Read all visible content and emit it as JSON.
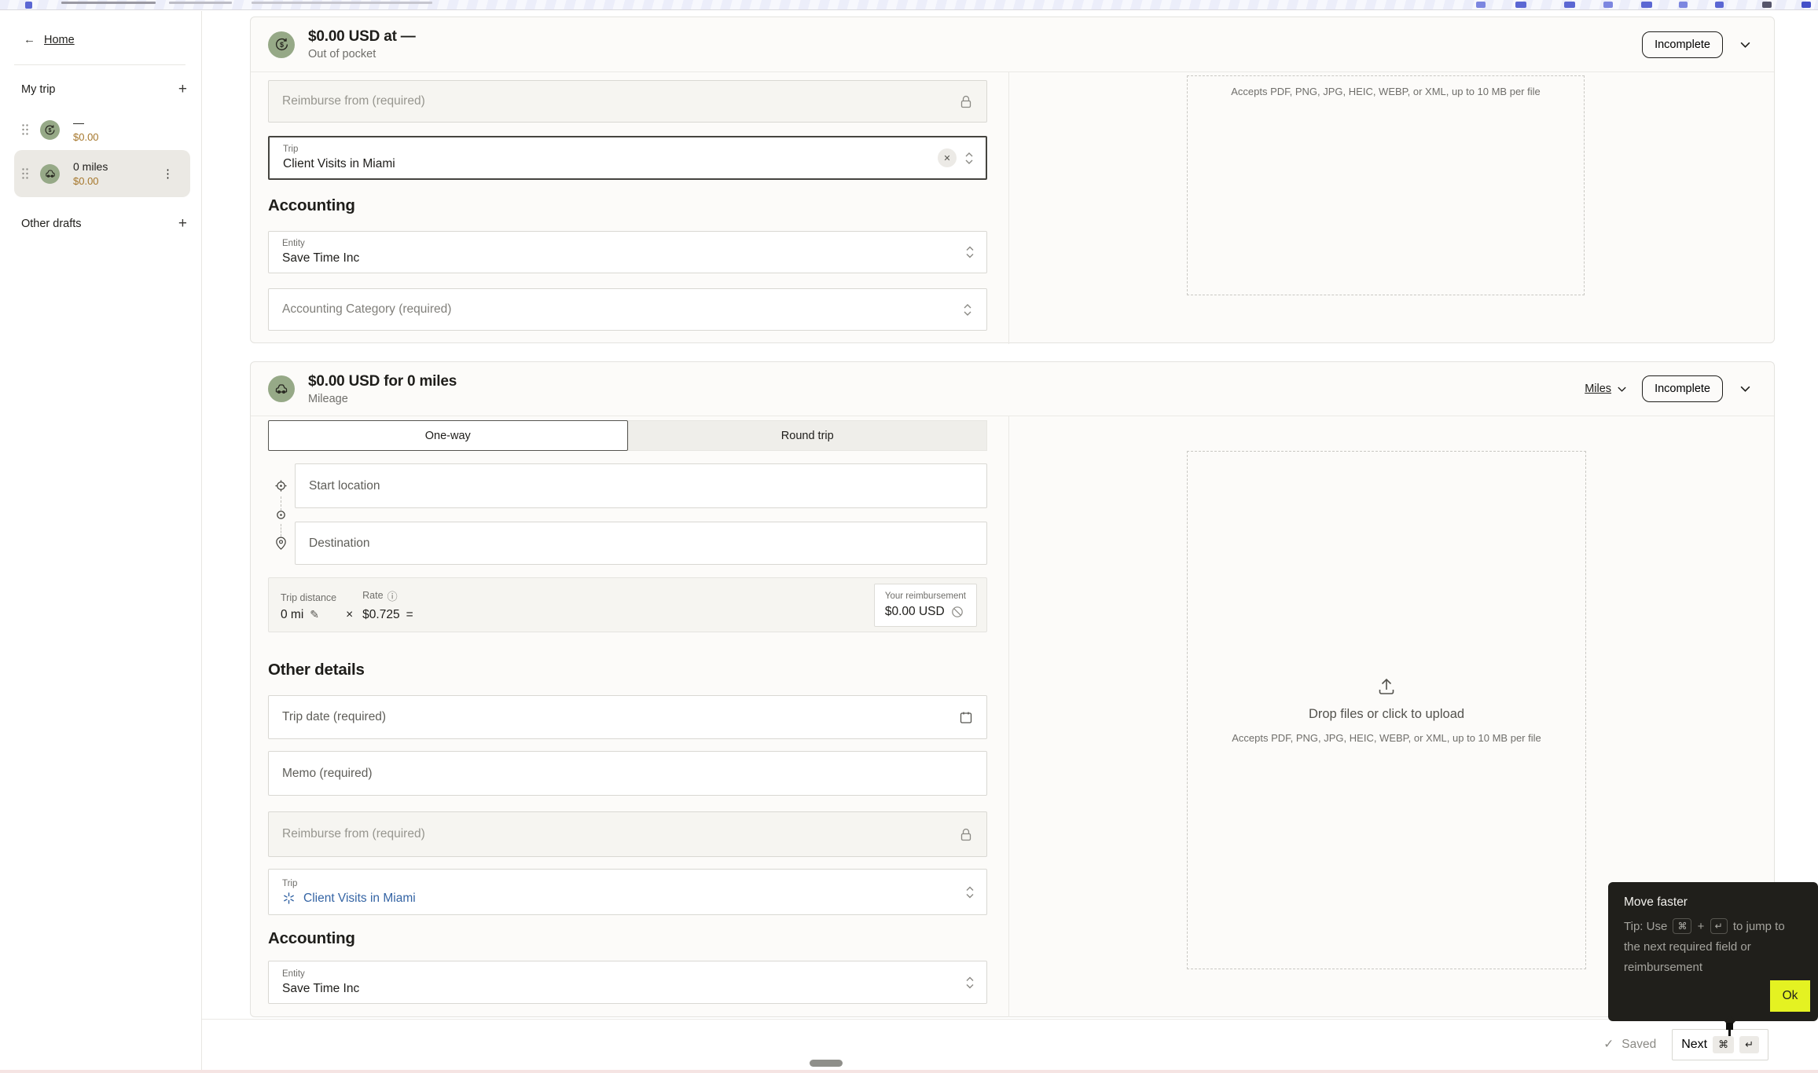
{
  "colors": {
    "accent_green": "#96a987",
    "amount_amber": "#a5762a",
    "link_blue": "#3464a4",
    "ok_yellow": "#e4f222",
    "tooltip_bg": "#201f1b"
  },
  "icons": {
    "back-arrow-icon": "←",
    "plus-icon": "+",
    "drag-handle-icon": "six-dot grid",
    "cash-back-icon": "dollar in circular arrow",
    "car-icon": "car outline",
    "kebab-menu-icon": "⋮",
    "lock-icon": "padlock",
    "select-chevrons-icon": "up-down chevrons",
    "clear-icon": "✕",
    "chevron-down-icon": "⌄",
    "calendar-icon": "calendar",
    "start-location-icon": "crosshair",
    "waypoint-icon": "dot in circle",
    "destination-icon": "map pin",
    "edit-icon": "✎",
    "info-icon": "ⓘ",
    "blocked-icon": "no-sign",
    "upload-icon": "arrow up from tray",
    "trip-icon": "starburst",
    "check-icon": "✓"
  },
  "sidebar": {
    "home_label": "Home",
    "my_trip_label": "My trip",
    "items": [
      {
        "title": "—",
        "amount": "$0.00"
      },
      {
        "title": "0 miles",
        "amount": "$0.00"
      }
    ],
    "other_drafts_label": "Other drafts"
  },
  "expense1": {
    "title": "$0.00 USD at —",
    "subtitle": "Out of pocket",
    "status": "Incomplete",
    "reimburse_placeholder": "Reimburse from (required)",
    "trip_label": "Trip",
    "trip_value": "Client Visits in Miami",
    "clear_glyph": "✕",
    "accounting_heading": "Accounting",
    "entity_label": "Entity",
    "entity_value": "Save Time Inc",
    "category_placeholder": "Accounting Category (required)",
    "upload_hint": "Accepts PDF, PNG, JPG, HEIC, WEBP, or XML, up to 10 MB per file"
  },
  "expense2": {
    "title": "$0.00 USD for 0 miles",
    "subtitle": "Mileage",
    "unit_label": "Miles",
    "status": "Incomplete",
    "tabs": [
      "One-way",
      "Round trip"
    ],
    "route": {
      "start_placeholder": "Start location",
      "destination_placeholder": "Destination"
    },
    "calc": {
      "distance_label": "Trip distance",
      "distance_value": "0 mi",
      "times": "×",
      "rate_label": "Rate",
      "rate_value": "$0.725",
      "equals": "=",
      "reimb_label": "Your reimbursement",
      "reimb_value": "$0.00 USD"
    },
    "other_details_heading": "Other details",
    "trip_date_placeholder": "Trip date (required)",
    "memo_placeholder": "Memo (required)",
    "reimburse_placeholder": "Reimburse from (required)",
    "trip_label": "Trip",
    "trip_value": "Client Visits in Miami",
    "accounting_heading": "Accounting",
    "entity_label": "Entity",
    "entity_value": "Save Time Inc",
    "upload": {
      "title": "Drop files or click to upload",
      "hint": "Accepts PDF, PNG, JPG, HEIC, WEBP, or XML, up to 10 MB per file"
    }
  },
  "tooltip": {
    "title": "Move faster",
    "tip_prefix": "Tip: Use",
    "cmd_key": "⌘",
    "plus": "+",
    "enter_key": "↵",
    "tip_suffix": "to jump to the next required field or reimbursement",
    "ok_label": "Ok"
  },
  "footer": {
    "check_glyph": "✓",
    "saved_label": "Saved",
    "next_label": "Next",
    "cmd_key": "⌘",
    "enter_key": "↵"
  }
}
